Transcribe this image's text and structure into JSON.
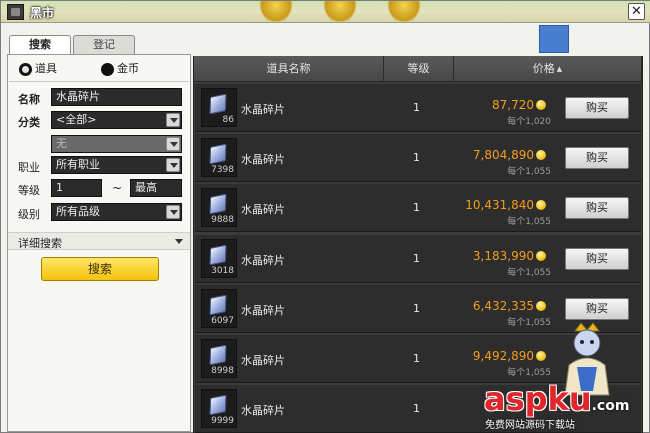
{
  "window": {
    "title": "黑市",
    "close_glyph": "✕"
  },
  "tabs": [
    {
      "label": "搜索",
      "active": true
    },
    {
      "label": "登记",
      "active": false
    }
  ],
  "search": {
    "mode_options": [
      {
        "label": "道具",
        "checked": true
      },
      {
        "label": "金币",
        "checked": false
      }
    ],
    "name_label": "名称",
    "name_value": "水晶碎片",
    "category_label": "分类",
    "category_value": "<全部>",
    "subcategory_value": "无",
    "job_label": "职业",
    "job_value": "所有职业",
    "level_label": "等级",
    "level_min": "1",
    "level_tilde": "~",
    "level_max": "最高",
    "grade_label": "级别",
    "grade_value": "所有品级",
    "detail_label": "详细搜索",
    "search_button": "搜索"
  },
  "table": {
    "headers": {
      "name": "道具名称",
      "level": "等级",
      "price": "价格"
    },
    "sort_icon": "▲",
    "buy_label": "购买",
    "rows": [
      {
        "qty": "86",
        "name": "水晶碎片",
        "level": "1",
        "price": "87,720",
        "each": "每个1,020",
        "buy": true
      },
      {
        "qty": "7398",
        "name": "水晶碎片",
        "level": "1",
        "price": "7,804,890",
        "each": "每个1,055",
        "buy": true
      },
      {
        "qty": "9888",
        "name": "水晶碎片",
        "level": "1",
        "price": "10,431,840",
        "each": "每个1,055",
        "buy": true
      },
      {
        "qty": "3018",
        "name": "水晶碎片",
        "level": "1",
        "price": "3,183,990",
        "each": "每个1,055",
        "buy": true
      },
      {
        "qty": "6097",
        "name": "水晶碎片",
        "level": "1",
        "price": "6,432,335",
        "each": "每个1,055",
        "buy": true
      },
      {
        "qty": "8998",
        "name": "水晶碎片",
        "level": "1",
        "price": "9,492,890",
        "each": "每个1,055",
        "buy": false
      },
      {
        "qty": "9999",
        "name": "水晶碎片",
        "level": "1",
        "price": "",
        "each": "",
        "buy": false
      }
    ]
  },
  "watermark": {
    "text": "aspku",
    "suffix": ".com",
    "subtitle": "免费网站源码下载站"
  },
  "colors": {
    "price": "#f39c1a",
    "search_button": "#f5c30d",
    "watermark": "#e0262b"
  }
}
